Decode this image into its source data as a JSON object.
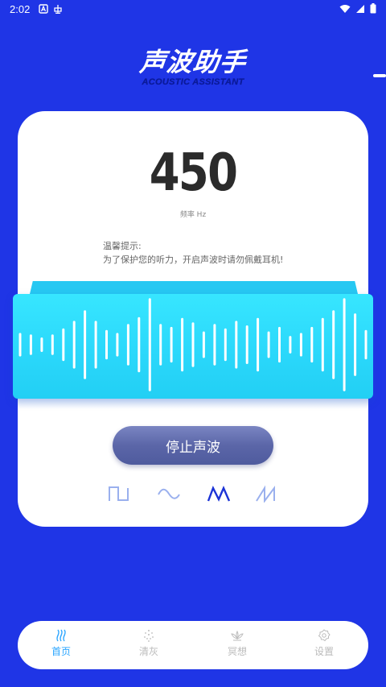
{
  "status_bar": {
    "time": "2:02"
  },
  "logo": {
    "title": "声波助手",
    "subtitle": "ACOUSTIC ASSISTANT"
  },
  "frequency": {
    "value": "450",
    "unit_label": "频率 Hz"
  },
  "tip": {
    "title": "温馨提示:",
    "body": "为了保护您的听力，开启声波时请勿佩戴耳机!"
  },
  "wave": {
    "bar_levels": [
      0.14,
      0.12,
      0.08,
      0.12,
      0.2,
      0.3,
      0.44,
      0.3,
      0.18,
      0.14,
      0.26,
      0.35,
      0.6,
      0.26,
      0.22,
      0.34,
      0.28,
      0.16,
      0.26,
      0.2,
      0.3,
      0.24,
      0.34,
      0.16,
      0.22,
      0.1,
      0.14,
      0.22,
      0.34,
      0.44,
      0.6,
      0.4,
      0.18
    ]
  },
  "controls": {
    "stop_label": "停止声波",
    "wave_types": [
      {
        "name": "square",
        "selected": false
      },
      {
        "name": "sine",
        "selected": false
      },
      {
        "name": "triangle",
        "selected": true
      },
      {
        "name": "sawtooth",
        "selected": false
      }
    ]
  },
  "nav": [
    {
      "label": "首页",
      "icon": "home-wave-icon",
      "active": true
    },
    {
      "label": "清灰",
      "icon": "dust-icon",
      "active": false
    },
    {
      "label": "冥想",
      "icon": "lotus-icon",
      "active": false
    },
    {
      "label": "设置",
      "icon": "gear-icon",
      "active": false
    }
  ],
  "colors": {
    "background": "#1f35e6",
    "wave_band": "#2bd8fb",
    "active_nav": "#2aa5ff",
    "button": "#5b66a8"
  }
}
